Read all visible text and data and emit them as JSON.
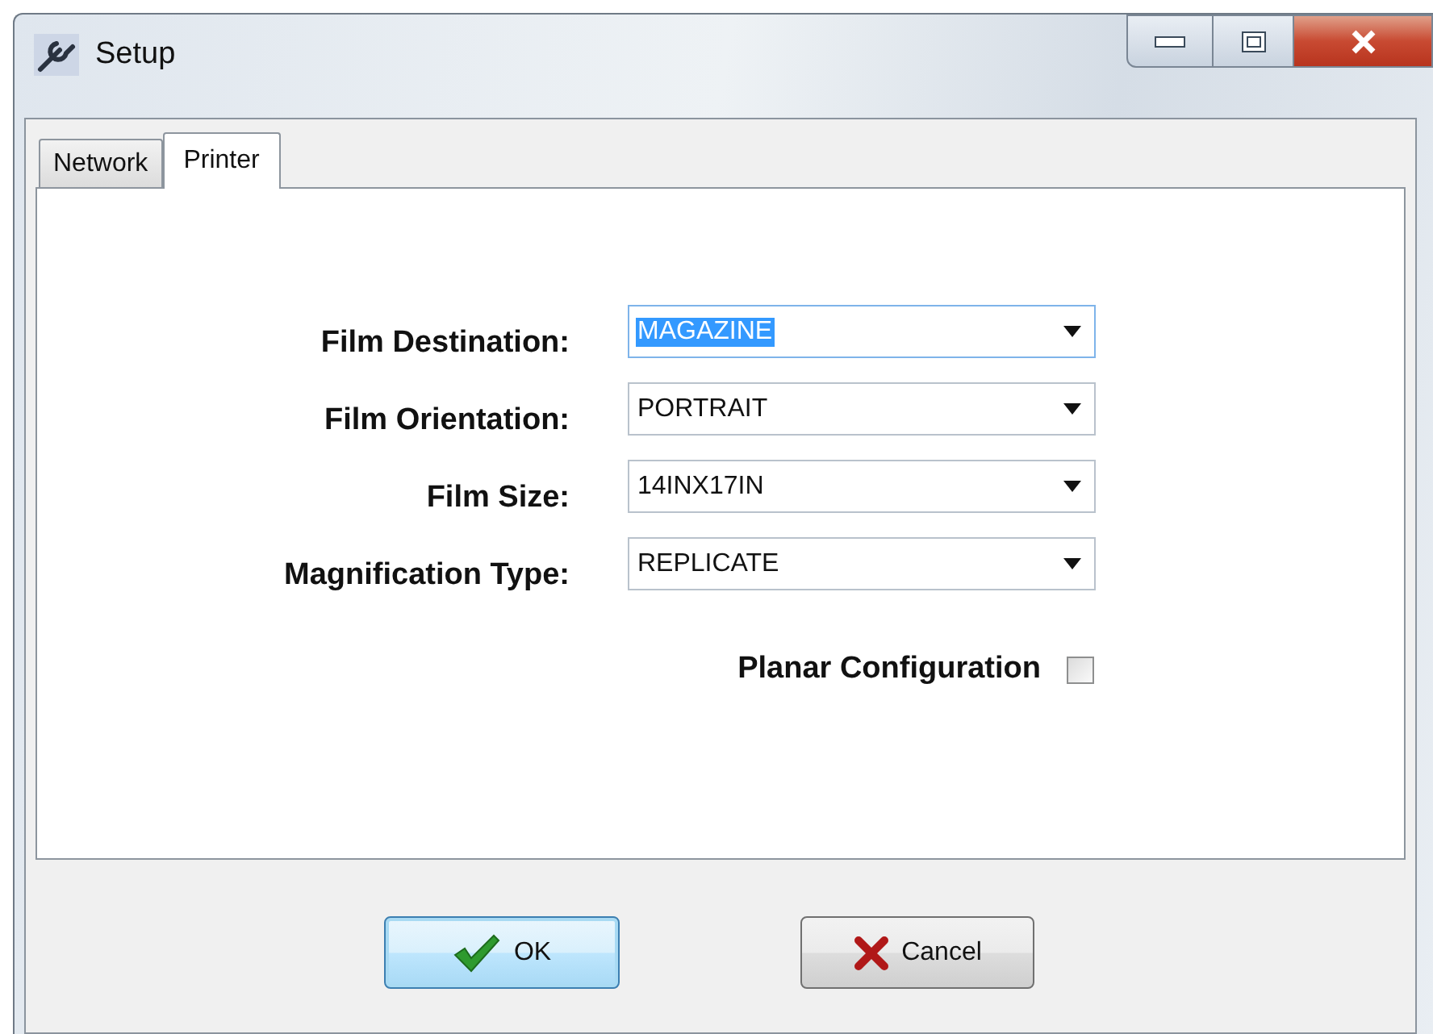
{
  "window": {
    "title": "Setup"
  },
  "tabs": [
    {
      "label": "Network",
      "selected": false
    },
    {
      "label": "Printer",
      "selected": true
    }
  ],
  "fields": [
    {
      "label": "Film Destination:",
      "value": "MAGAZINE",
      "focused": true
    },
    {
      "label": "Film Orientation:",
      "value": "PORTRAIT",
      "focused": false
    },
    {
      "label": "Film Size:",
      "value": "14INX17IN",
      "focused": false
    },
    {
      "label": "Magnification Type:",
      "value": "REPLICATE",
      "focused": false
    }
  ],
  "checkbox": {
    "label": "Planar Configuration",
    "checked": false
  },
  "buttons": [
    {
      "label": "OK",
      "kind": "ok",
      "default": true
    },
    {
      "label": "Cancel",
      "kind": "cancel",
      "default": false
    }
  ]
}
